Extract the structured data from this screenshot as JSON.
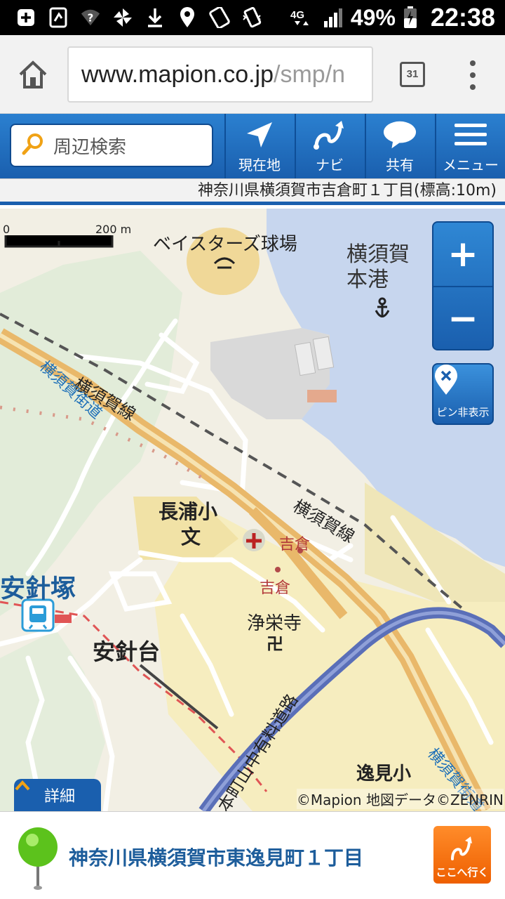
{
  "status_bar": {
    "icons": [
      "plus-box-icon",
      "nfc-icon",
      "wifi-unknown-icon",
      "pinwheel-icon",
      "download-icon",
      "location-icon",
      "touch-icon",
      "vibrate-icon",
      "4g-icon",
      "signal-icon",
      "battery-icon"
    ],
    "network": "4G",
    "battery": "49%",
    "time": "22:38"
  },
  "browser": {
    "url_host": "www.mapion.co.jp",
    "url_path": "/smp/n",
    "tab_count": "31"
  },
  "toolbar": {
    "search_placeholder": "周辺検索",
    "buttons": [
      {
        "label": "現在地",
        "icon": "current-location-icon"
      },
      {
        "label": "ナビ",
        "icon": "navi-icon"
      },
      {
        "label": "共有",
        "icon": "share-bubble-icon"
      },
      {
        "label": "メニュー",
        "icon": "menu-icon"
      }
    ]
  },
  "address_bar": "神奈川県横須賀市吉倉町１丁目(標高:10m)",
  "map": {
    "scale": {
      "zero": "0",
      "distance": "200 m"
    },
    "labels": {
      "stadium": "ベイスターズ球場",
      "port_line1": "横須賀",
      "port_line2": "本港",
      "rail_line_1": "横須賀線",
      "rail_line_2": "横須賀線",
      "street_1": "横須賀街道",
      "street_2": "横須賀街道",
      "school": "長浦小",
      "school_symbol": "文",
      "area_yoshikura_1": "吉倉",
      "area_yoshikura_2": "吉倉",
      "temple": "浄栄寺",
      "temple_symbol": "卍",
      "station": "安針塚",
      "district": "安針台",
      "toll_road": "本町山中有料道路",
      "partial_label": "逸見小"
    },
    "zoom_in": "+",
    "zoom_out": "−",
    "pin_toggle": "ピン非表示",
    "detail_tab": "詳細",
    "copyright": "©Mapion 地図データ©ZENRIN"
  },
  "bottom": {
    "address": "神奈川県横須賀市東逸見町１丁目",
    "goto_label": "ここへ行く"
  },
  "colors": {
    "brand_blue": "#1a5fae",
    "goto_orange": "#ee5f00",
    "water": "#c7d6ee",
    "marker_green": "#5cc21c"
  }
}
